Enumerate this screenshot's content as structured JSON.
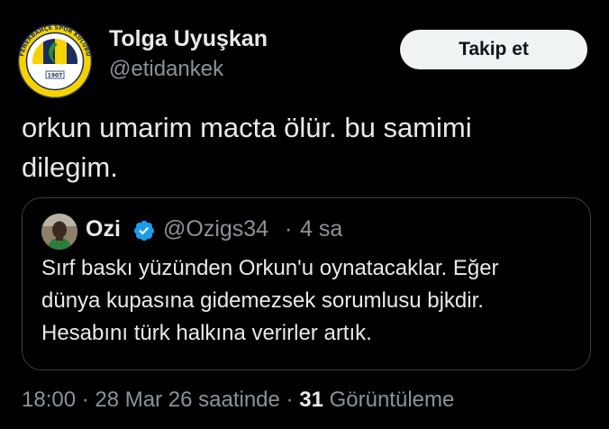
{
  "author": {
    "name": "Tolga Uyuşkan",
    "handle": "@etidankek",
    "avatar_icon": "fenerbahce-crest-icon",
    "avatar_ring_text": "FENERBAHÇE SPOR KULÜBÜ",
    "avatar_year": "1907"
  },
  "follow_button": {
    "label": "Takip et"
  },
  "tweet": {
    "text_line1": "orkun umarim macta ölür. bu samimi",
    "text_line2": "dilegim."
  },
  "quoted_tweet": {
    "name": "Ozi",
    "verified_icon": "verified-badge-icon",
    "handle": "@Ozigs34",
    "separator": "·",
    "time": "4 sa",
    "text_line1": "Sırf baskı yüzünden Orkun'u oynatacaklar. Eğer",
    "text_line2": "dünya kupasına gidemezsek sorumlusu bjkdir.",
    "text_line3": "Hesabını türk halkına verirler artık."
  },
  "footer": {
    "time": "18:00",
    "sep1": "·",
    "date": "28 Mar 26 saatinde",
    "sep2": "·",
    "views_count": "31",
    "views_label": "Görüntüleme"
  },
  "colors": {
    "background": "#000000",
    "primary_text": "#e7e9ea",
    "secondary_text": "#8b9299",
    "button_bg": "#eff3f4",
    "verified_blue": "#1d9bf0",
    "fenerbahce_navy": "#1b2d5c",
    "fenerbahce_yellow": "#f5d200"
  }
}
